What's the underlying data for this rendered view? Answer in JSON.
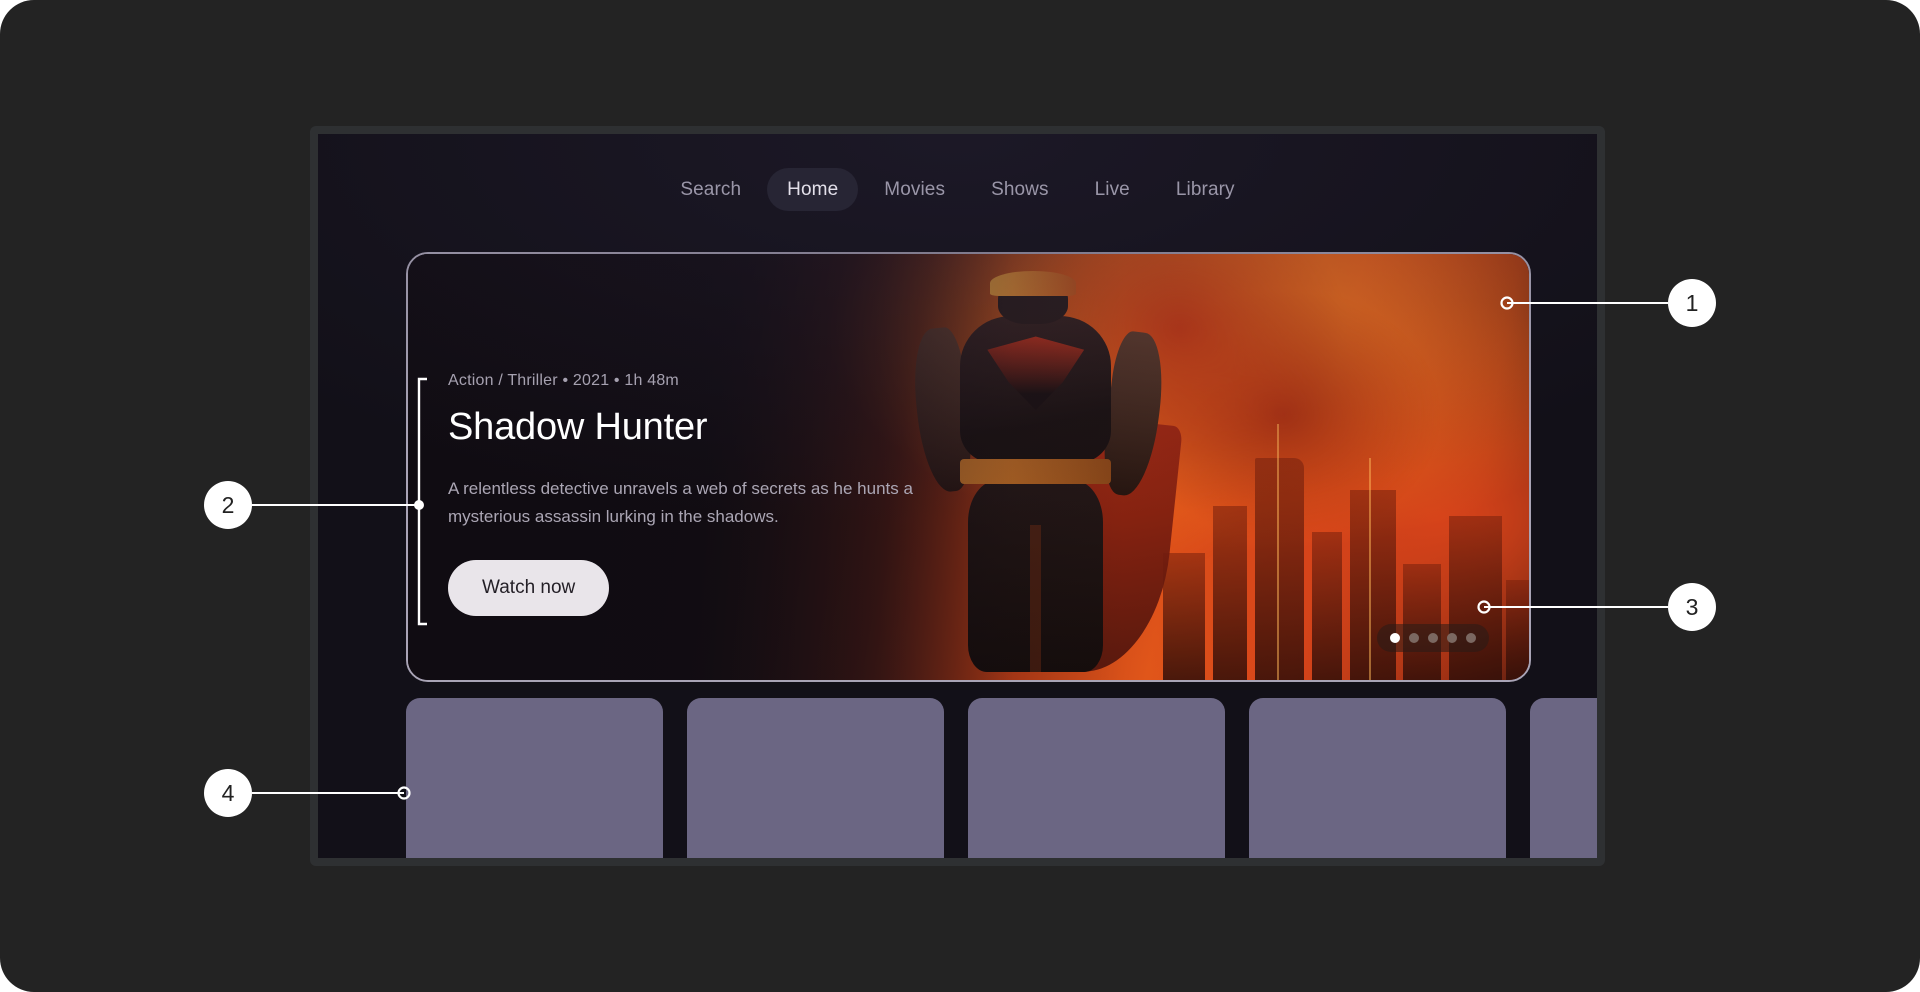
{
  "app": {
    "nav": [
      {
        "label": "Search",
        "active": false
      },
      {
        "label": "Home",
        "active": true
      },
      {
        "label": "Movies",
        "active": false
      },
      {
        "label": "Shows",
        "active": false
      },
      {
        "label": "Live",
        "active": false
      },
      {
        "label": "Library",
        "active": false
      }
    ]
  },
  "hero": {
    "meta": "Action / Thriller • 2021 • 1h 48m",
    "title": "Shadow Hunter",
    "description": "A relentless detective unravels a web of secrets as he hunts a mysterious assassin lurking in the shadows.",
    "cta_label": "Watch now",
    "carousel": {
      "total": 5,
      "active_index": 0
    }
  },
  "poster_rail": {
    "count": 5
  },
  "annotations": [
    {
      "id": "1",
      "label": "1"
    },
    {
      "id": "2",
      "label": "2"
    },
    {
      "id": "3",
      "label": "3"
    },
    {
      "id": "4",
      "label": "4"
    }
  ],
  "colors": {
    "page_background": "#232323",
    "bezel": "#2e3032",
    "screen_background": "#121018",
    "nav_text": "#9a96a8",
    "nav_active_background": "#272534",
    "nav_active_text": "#e3e0ea",
    "hero_border": "#a9a4b6",
    "hero_title": "#ffffff",
    "hero_meta": "#a6a1b0",
    "hero_description": "#aba6b4",
    "cta_background": "#e9e5ea",
    "cta_text": "#231f26",
    "poster_card": "#6b6683",
    "dot_active": "#ffffff",
    "dot_inactive": "#7b6861",
    "callout_background": "#ffffff",
    "callout_text": "#222222",
    "annotation_line": "#ffffff"
  }
}
